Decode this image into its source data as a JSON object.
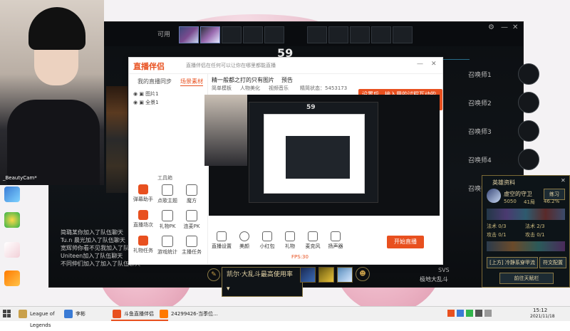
{
  "webcam": {
    "label": "_BeautyCam*"
  },
  "game": {
    "pick_label": "可用",
    "timer": "59",
    "summoners": [
      "召唤师1",
      "召唤师2",
      "召唤师3",
      "召唤师4",
      "召唤师5"
    ],
    "chat_lines": [
      "简璐某你加入了队伍聊天",
      "Tu.n 晨光加入了队伍聊天",
      "宽辉帅你看不见我加入了队伍聊天",
      "Uniteen加入了队伍聊天",
      "不同伸们加入了加入了队伍聊天"
    ],
    "champion_dropdown": "凯尔·大乱斗最高使用率",
    "footer_left": "SVS",
    "footer_mode": "极地大乱斗",
    "colors": {
      "accent": "#e8501f",
      "gold": "#c9a04a"
    }
  },
  "app": {
    "logo_text": "直播伴侣",
    "nav": [
      "我的直播",
      "同步",
      "场景素材"
    ],
    "active_nav": "场景素材",
    "layer_items": [
      "图片1",
      "全景1"
    ],
    "tools_label": "工具箱",
    "tools": [
      "弹幕助手",
      "点歌主题",
      "魔方",
      "直播场次",
      "礼物PK",
      "连麦PK",
      "礼物任务",
      "游戏统计",
      "主播任务",
      "搜索助手",
      "互动消息",
      "最新活动"
    ],
    "tab_bar": [
      "精一般都之打的",
      "只有图片",
      "预告"
    ],
    "sub_tabs": [
      "简单模板",
      "人物美化",
      "视频音乐"
    ],
    "info_text": "精简状态：5453173",
    "alert_text": "设置后，接入用的过程互动的直播",
    "status_text": "直播伴侣在任何可以让你在哪里都能直播",
    "bottom_tools": [
      "直播设置",
      "美颜",
      "小红包",
      "礼物",
      "麦克风",
      "扬声器"
    ],
    "start_button": "开始直播",
    "kbps_text": "FPS:30"
  },
  "profile": {
    "title": "英雄资料",
    "name": "虚空的守卫",
    "badge": "练习",
    "stats": [
      "5050",
      "41局",
      "46.2%"
    ],
    "rows": [
      "法术 0/3",
      "法术 2/3",
      "攻击 0/1",
      "攻击 0/1"
    ],
    "rune_label": "[上方] 冷静系穿甲流",
    "button_main": "符文配置",
    "button_bottom": "前往天赋栏"
  },
  "taskbar": {
    "items": [
      "League of Legends",
      "李彬",
      "斗鱼直播伴侣",
      "24299426-当季位..."
    ],
    "clock": "15:12",
    "date": "2021/11/18"
  }
}
